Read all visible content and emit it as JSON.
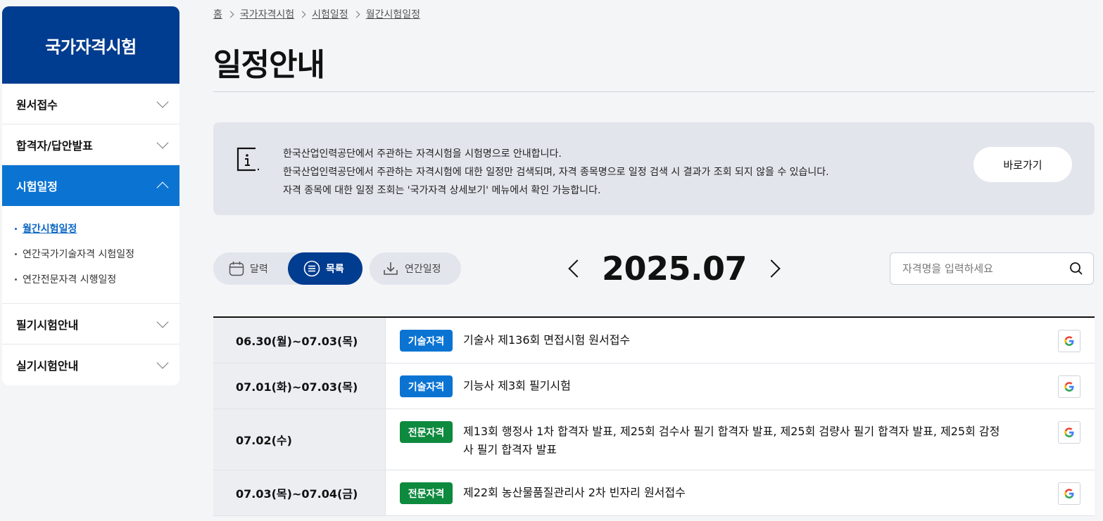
{
  "sidebar": {
    "title": "국가자격시험",
    "items": [
      {
        "label": "원서접수"
      },
      {
        "label": "합격자/답안발표"
      },
      {
        "label": "시험일정"
      },
      {
        "label": "필기시험안내"
      },
      {
        "label": "실기시험안내"
      }
    ],
    "subitems": [
      {
        "label": "월간시험일정"
      },
      {
        "label": "연간국가기술자격 시험일정"
      },
      {
        "label": "연간전문자격 시행일정"
      }
    ]
  },
  "breadcrumb": [
    "홈",
    "국가자격시험",
    "시험일정",
    "월간시험일정"
  ],
  "page_title": "일정안내",
  "info": {
    "lines": [
      "한국산업인력공단에서 주관하는 자격시험을 시험명으로 안내합니다.",
      "한국산업인력공단에서 주관하는 자격시험에 대한 일정만 검색되며, 자격 종목명으로 일정 검색 시 결과가 조회 되지 않을 수 있습니다.",
      "자격 종목에 대한 일정 조회는 '국가자격 상세보기' 메뉴에서 확인 가능합니다."
    ],
    "button": "바로가기"
  },
  "view_toggle": {
    "calendar": "달력",
    "list": "목록",
    "annual": "연간일정"
  },
  "month": "2025.07",
  "search": {
    "placeholder": "자격명을 입력하세요",
    "value": ""
  },
  "events": [
    {
      "date": "06.30(월)~07.03(목)",
      "badge": "기술자격",
      "title": "기술사 제136회 면접시험 원서접수"
    },
    {
      "date": "07.01(화)~07.03(목)",
      "badge": "기술자격",
      "title": "기능사 제3회 필기시험"
    },
    {
      "date": "07.02(수)",
      "badge": "전문자격",
      "title": "제13회 행정사 1차 합격자 발표, 제25회 검수사 필기 합격자 발표, 제25회 검량사 필기 합격자 발표, 제25회 감정사 필기 합격자 발표"
    },
    {
      "date": "07.03(목)~07.04(금)",
      "badge": "전문자격",
      "title": "제22회 농산물품질관리사 2차 빈자리 원서접수"
    }
  ],
  "colors": {
    "primary": "#003c8f",
    "accent": "#0b74d3",
    "tech_badge": "#0b74d3",
    "pro_badge": "#0e8a3e"
  }
}
